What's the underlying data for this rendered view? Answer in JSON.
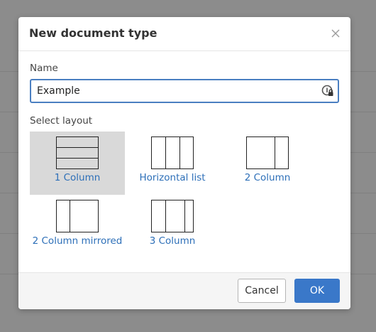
{
  "dialog": {
    "title": "New document type",
    "close_icon": "close-icon"
  },
  "name_field": {
    "label": "Name",
    "value": "Example",
    "icon": "password-manager-icon"
  },
  "layout_section": {
    "label": "Select layout",
    "selected": "1 Column",
    "options": [
      {
        "label": "1 Column",
        "icon": "one-column-layout-icon"
      },
      {
        "label": "Horizontal list",
        "icon": "horizontal-list-layout-icon"
      },
      {
        "label": "2 Column",
        "icon": "two-column-layout-icon"
      },
      {
        "label": "2 Column mirrored",
        "icon": "two-column-mirrored-layout-icon"
      },
      {
        "label": "3 Column",
        "icon": "three-column-layout-icon"
      }
    ]
  },
  "footer": {
    "cancel_label": "Cancel",
    "ok_label": "OK"
  },
  "colors": {
    "accent": "#3a78c9",
    "link": "#2d6fb8",
    "selected_bg": "#d9d9d9"
  }
}
